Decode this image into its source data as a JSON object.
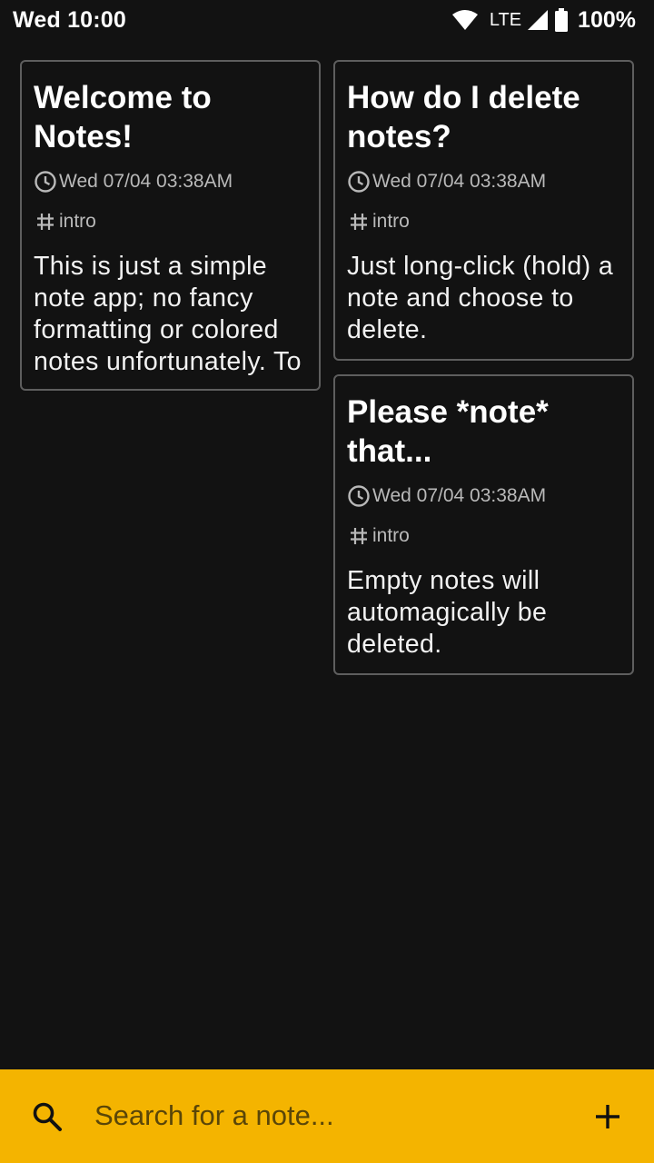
{
  "status_bar": {
    "time": "Wed 10:00",
    "network": "LTE",
    "battery": "100%",
    "icons": [
      "wifi-icon",
      "signal-icon",
      "battery-icon"
    ]
  },
  "notes": [
    {
      "title": "Welcome to Notes!",
      "timestamp": "Wed 07/04 03:38AM",
      "tag": "intro",
      "body": "This is just a simple note app; no fancy formatting or colored notes unfortunately. To get started, delete"
    },
    {
      "title": "How do I delete notes?",
      "timestamp": "Wed 07/04 03:38AM",
      "tag": "intro",
      "body": "Just long-click (hold) a note and choose to delete."
    },
    {
      "title": "Please *note* that...",
      "timestamp": "Wed 07/04 03:38AM",
      "tag": "intro",
      "body": "Empty notes will automagically be deleted."
    }
  ],
  "search": {
    "placeholder": "Search for a note...",
    "icon": "search-icon"
  },
  "add_button": {
    "icon": "plus-icon"
  },
  "colors": {
    "background": "#121212",
    "card_border": "#5e5e5e",
    "accent_bar": "#f4b400",
    "meta_text": "#b9b9b9"
  }
}
